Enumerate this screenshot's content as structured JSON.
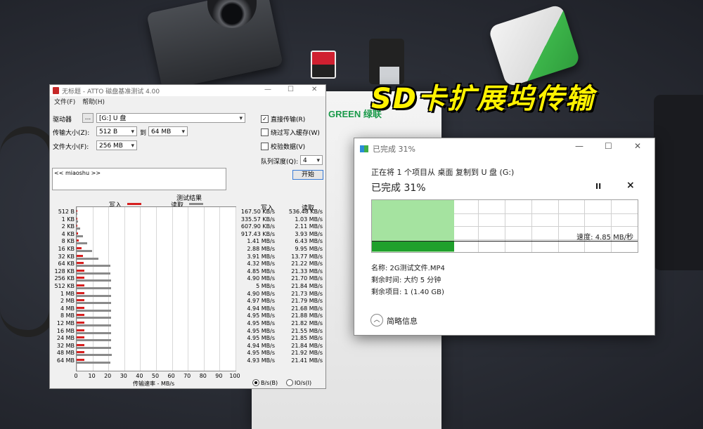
{
  "headline": "SD卡扩展坞传输",
  "background": {
    "box_brand": "GREEN 绿联"
  },
  "atto": {
    "title": "无标题 - ATTO 磁盘基准测试 4.00",
    "menu": [
      "文件(F)",
      "帮助(H)"
    ],
    "drive_label": "驱动器",
    "browse": "...",
    "drive_value": "[G:] U 盘",
    "transfer_label": "传输大小(Z):",
    "transfer_from": "512 B",
    "transfer_to_label": "到",
    "transfer_to": "64 MB",
    "file_label": "文件大小(F):",
    "file_value": "256 MB",
    "direct_io": "直接传输(R)",
    "bypass_cache": "绕过写入缓存(W)",
    "verify": "校验数据(V)",
    "queue_label": "队列深度(Q):",
    "queue_value": "4",
    "description": "<< miaoshu >>",
    "start": "开始",
    "results_title": "测试结果",
    "legend_write": "写入",
    "legend_read": "读取",
    "col_write": "写入",
    "col_read": "读取",
    "x_label": "传输速率 - MB/s",
    "unit_bytes": "B/s(B)",
    "unit_io": "IO/s(I)",
    "colors": {
      "write": "#d62020",
      "read": "#8a8a8a"
    }
  },
  "chart_data": {
    "type": "bar",
    "orientation": "horizontal",
    "title": "测试结果",
    "xlabel": "传输速率 - MB/s",
    "xlim": [
      0,
      100
    ],
    "xticks": [
      0,
      10,
      20,
      30,
      40,
      50,
      60,
      70,
      80,
      90,
      100
    ],
    "grid": true,
    "legend": "top",
    "categories": [
      "512 B",
      "1 KB",
      "2 KB",
      "4 KB",
      "8 KB",
      "16 KB",
      "32 KB",
      "64 KB",
      "128 KB",
      "256 KB",
      "512 KB",
      "1 MB",
      "2 MB",
      "4 MB",
      "8 MB",
      "12 MB",
      "16 MB",
      "24 MB",
      "32 MB",
      "48 MB",
      "64 MB"
    ],
    "series": [
      {
        "name": "写入",
        "values": [
          0.16,
          0.33,
          0.59,
          0.9,
          1.41,
          2.88,
          3.91,
          4.32,
          4.85,
          4.9,
          5,
          4.9,
          4.97,
          4.94,
          4.95,
          4.95,
          4.95,
          4.95,
          4.94,
          4.95,
          4.93
        ],
        "labels": [
          "167.50 KB/s",
          "335.57 KB/s",
          "607.90 KB/s",
          "917.43 KB/s",
          "1.41 MB/s",
          "2.88 MB/s",
          "3.91 MB/s",
          "4.32 MB/s",
          "4.85 MB/s",
          "4.90 MB/s",
          "5 MB/s",
          "4.90 MB/s",
          "4.97 MB/s",
          "4.94 MB/s",
          "4.95 MB/s",
          "4.95 MB/s",
          "4.95 MB/s",
          "4.95 MB/s",
          "4.94 MB/s",
          "4.95 MB/s",
          "4.93 MB/s"
        ]
      },
      {
        "name": "读取",
        "values": [
          0.52,
          1.03,
          2.11,
          3.93,
          6.43,
          9.95,
          13.77,
          21.22,
          21.33,
          21.7,
          21.84,
          21.73,
          21.79,
          21.68,
          21.88,
          21.82,
          21.55,
          21.85,
          21.84,
          21.92,
          21.41
        ],
        "labels": [
          "536.48 KB/s",
          "1.03 MB/s",
          "2.11 MB/s",
          "3.93 MB/s",
          "6.43 MB/s",
          "9.95 MB/s",
          "13.77 MB/s",
          "21.22 MB/s",
          "21.33 MB/s",
          "21.70 MB/s",
          "21.84 MB/s",
          "21.73 MB/s",
          "21.79 MB/s",
          "21.68 MB/s",
          "21.88 MB/s",
          "21.82 MB/s",
          "21.55 MB/s",
          "21.85 MB/s",
          "21.84 MB/s",
          "21.92 MB/s",
          "21.41 MB/s"
        ]
      }
    ]
  },
  "copy": {
    "title": "已完成 31%",
    "line1": "正在将 1 个项目从 桌面 复制到 U 盘 (G:)",
    "percent_label": "已完成 31%",
    "progress": 0.31,
    "speed": "速度: 4.85 MB/秒",
    "name": "名称: 2G测试文件.MP4",
    "time_left": "剩余时间: 大约 5 分钟",
    "items_left": "剩余项目: 1 (1.40 GB)",
    "less_details": "简略信息",
    "pause": "II",
    "cancel": "×",
    "colors": {
      "fill": "#a5e3a0",
      "current": "#1fa02c"
    }
  }
}
